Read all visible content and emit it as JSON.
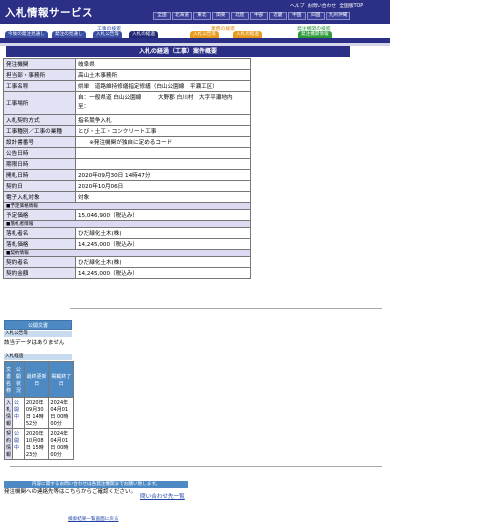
{
  "header": {
    "logo": "入札情報サービス",
    "top_links": [
      "ヘルプ",
      "お問い合わせ",
      "全国版TOP"
    ],
    "regions": [
      "全国",
      "北海道",
      "東北",
      "関東",
      "北陸",
      "中部",
      "近畿",
      "中国",
      "四国",
      "九州沖縄"
    ]
  },
  "categories": {
    "construction": "工事の検索",
    "business": "業務の検索",
    "org": "発注機関の検索"
  },
  "tabs": [
    "今後の発注見通し",
    "発注の見通し",
    "入札公告等",
    "入札の経過",
    "入札公告等",
    "入札の経過",
    "発注機関情報"
  ],
  "page_title": "入札の経過（工事）案件概要",
  "detail": {
    "rows": [
      {
        "label": "発注機関",
        "value": "岐阜県"
      },
      {
        "label": "担当部・事務所",
        "value": "高山土木事務所"
      },
      {
        "label": "工事名称",
        "value": "県単　道路維持修繕指定修繕（白山公園線　平瀬工区）"
      },
      {
        "label": "工事場所",
        "value": "自：一般県道 白山公園線　　　大野郡 白川村　大字平瀬地内\n至："
      },
      {
        "label": "入札契約方式",
        "value": "指名競争入札"
      },
      {
        "label": "工事種別／工事の業種",
        "value": "とび・土工・コンクリート工事"
      },
      {
        "label": "設計書番号",
        "value": "　　※発注機関が独自に定めるコード"
      },
      {
        "label": "公告日時",
        "value": ""
      },
      {
        "label": "期限日時",
        "value": ""
      },
      {
        "label": "開札日時",
        "value": "2020年09月30日 14時47分"
      },
      {
        "label": "契約日",
        "value": "2020年10月06日"
      },
      {
        "label": "電子入札対象",
        "value": "対象"
      }
    ],
    "yotei_section": "■予定価格情報",
    "yotei_label": "予定価格",
    "yotei_value": "15,046,900（税込み）",
    "rakusatsu_section": "■落札者情報",
    "rakusatsu_name_label": "落札者名",
    "rakusatsu_name_value": "ひだ緑化土木(株)",
    "rakusatsu_price_label": "落札価格",
    "rakusatsu_price_value": "14,245,000（税込み）",
    "keiyaku_section": "■契約情報",
    "keiyaku_name_label": "契約者名",
    "keiyaku_name_value": "ひだ緑化土木(株)",
    "keiyaku_price_label": "契約金額",
    "keiyaku_price_value": "14,245,000（税込み）"
  },
  "pub_docs": {
    "heading": "公開文書",
    "koukoku_label": "入札公告等",
    "koukoku_none": "該当データはありません",
    "keika_label": "入札経過",
    "columns": [
      "文書名称",
      "公開状況",
      "最終更新日",
      "掲載終了日"
    ],
    "rows": [
      {
        "name": "入札情報",
        "status": "公開中",
        "updated": "2020年09月30日 14時52分",
        "end": "2024年04月01日 00時00分"
      },
      {
        "name": "契約情報",
        "status": "公開中",
        "updated": "2020年10月08日 15時23分",
        "end": "2024年04月01日 00時00分"
      }
    ]
  },
  "contact": {
    "heading": "内容に関するお問い合わせは各発注機関までお願い致します。",
    "text": "発注機関への連絡先等はこちらからご確認ください。",
    "link": "問い合わせ先一覧"
  },
  "back_link": "検索結果一覧画面に戻る",
  "colors": {
    "header": "#2b2f86",
    "tab_blue": "#3a4fa3",
    "tab_orange": "#e89a1c",
    "tab_green": "#2f9a3a",
    "label_bg": "#e2e2f5",
    "pub_blue": "#4d8ac4"
  }
}
